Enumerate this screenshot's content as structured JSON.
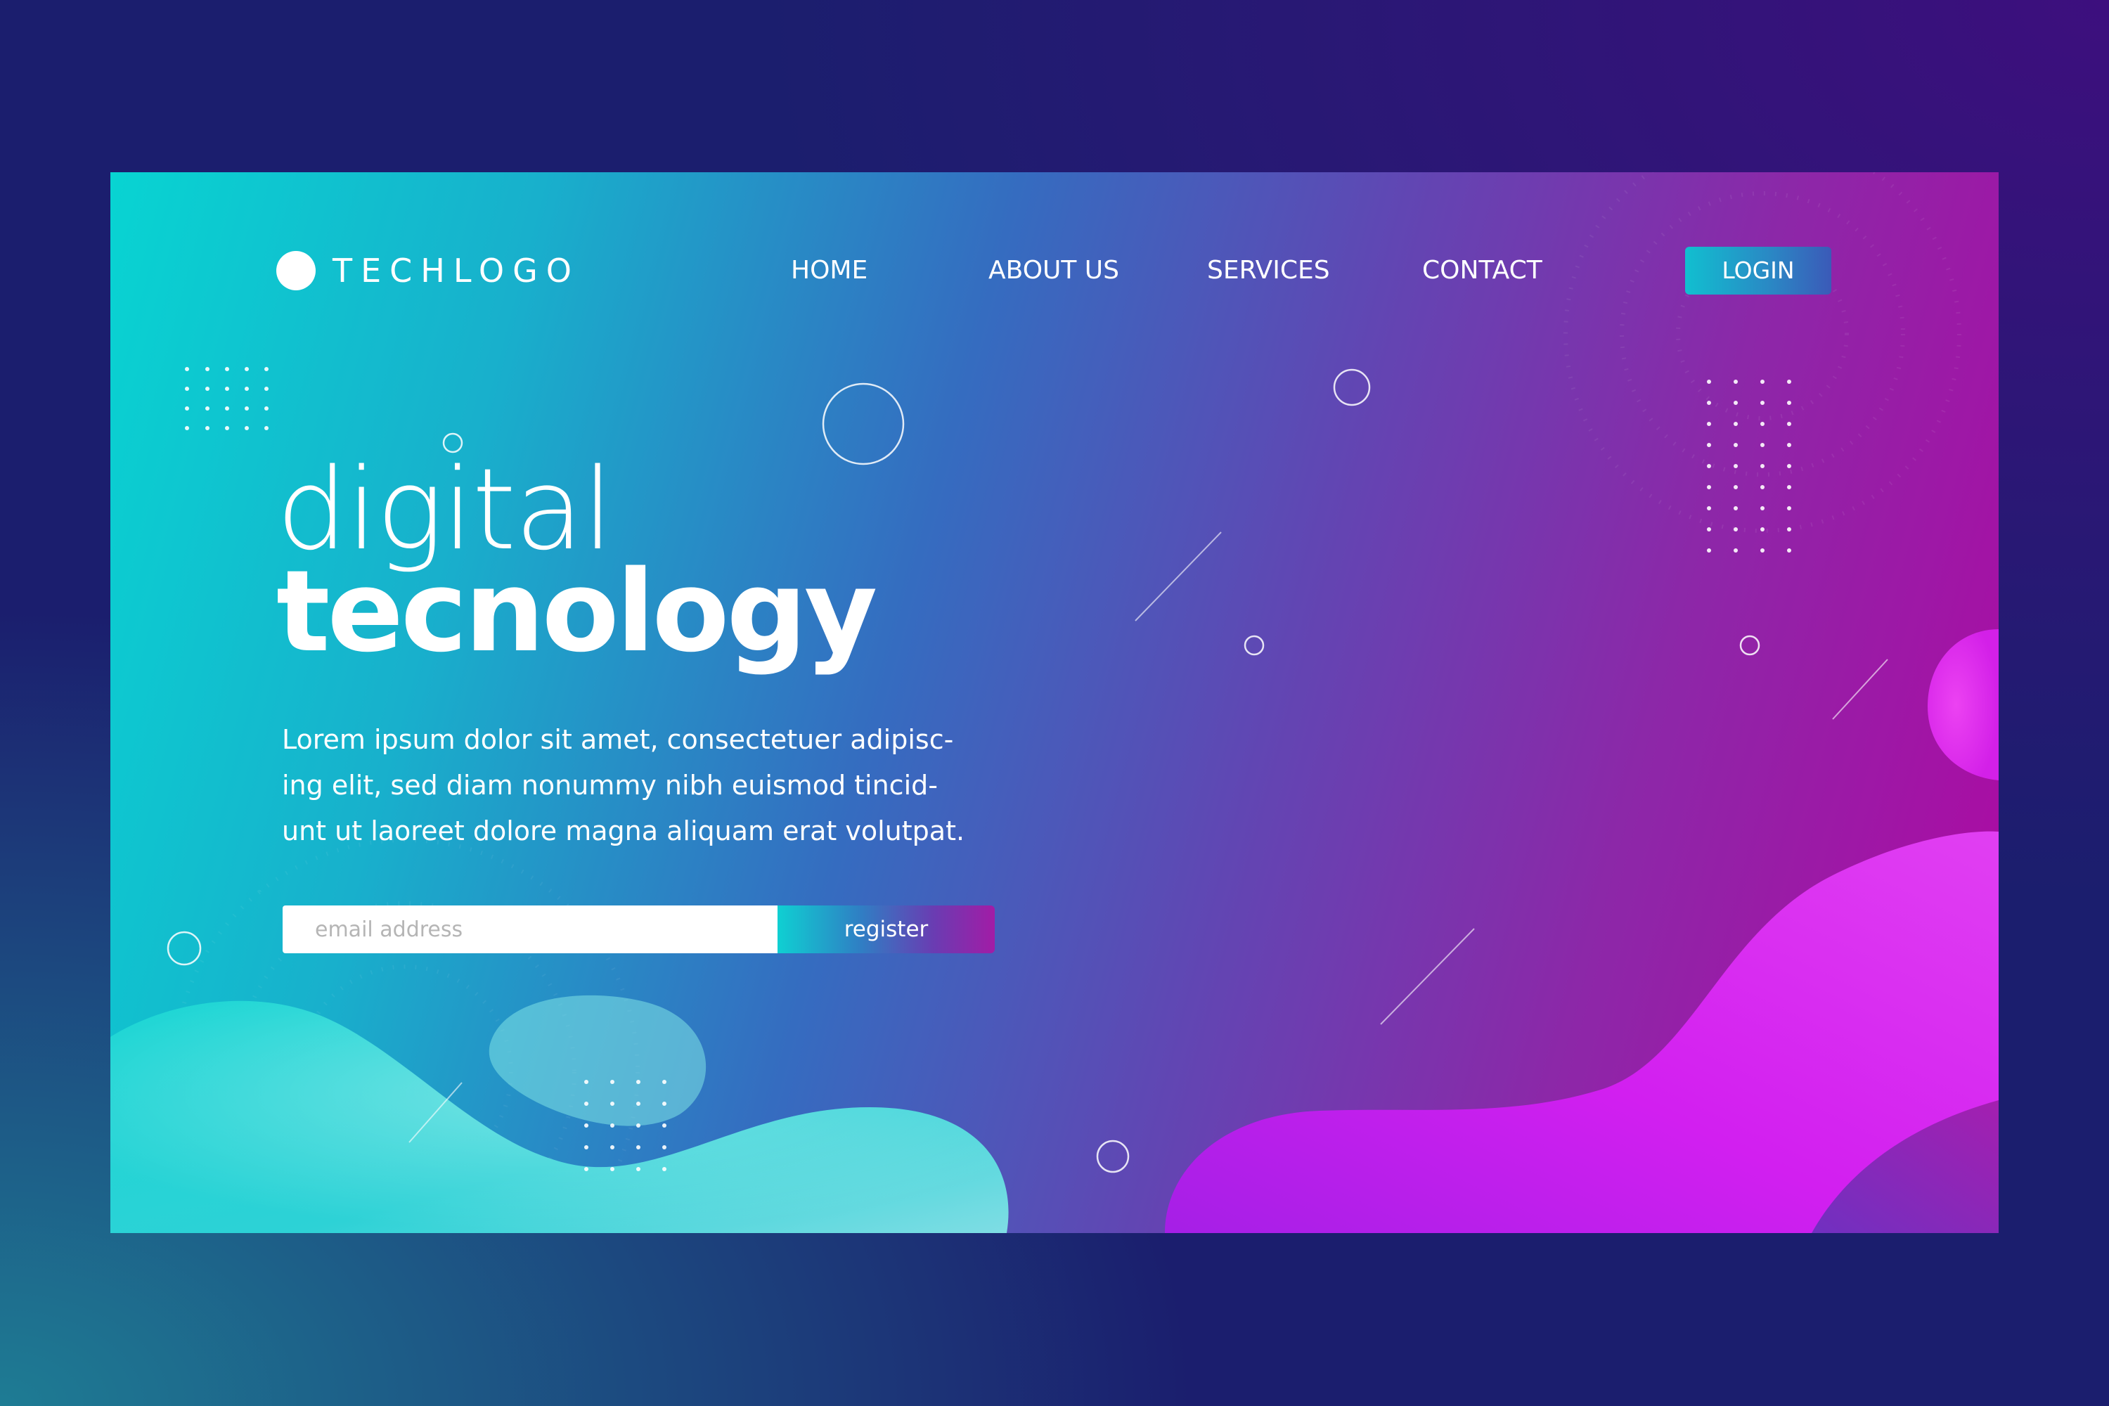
{
  "brand": {
    "logo_text": "TECHLOGO",
    "logo_icon": "circle-logo-icon"
  },
  "nav": {
    "items": [
      {
        "label": "HOME"
      },
      {
        "label": "ABOUT US"
      },
      {
        "label": "SERVICES"
      },
      {
        "label": "CONTACT"
      }
    ],
    "login_label": "LOGIN"
  },
  "hero": {
    "title_light": "digital",
    "title_bold": "tecnology",
    "description_lines": [
      "Lorem ipsum dolor sit amet, consectetuer adipisc-",
      "ing elit, sed diam nonummy nibh euismod tincid-",
      "unt ut laoreet dolore magna aliquam erat volutpat."
    ]
  },
  "signup": {
    "email_placeholder": "email address",
    "email_value": "",
    "register_label": "register"
  },
  "colors": {
    "cyan": "#08d4d2",
    "blue": "#356cc0",
    "magenta": "#b007a3",
    "blob_magenta": "#d41ff0",
    "outer_background": "#1b1e6e"
  }
}
